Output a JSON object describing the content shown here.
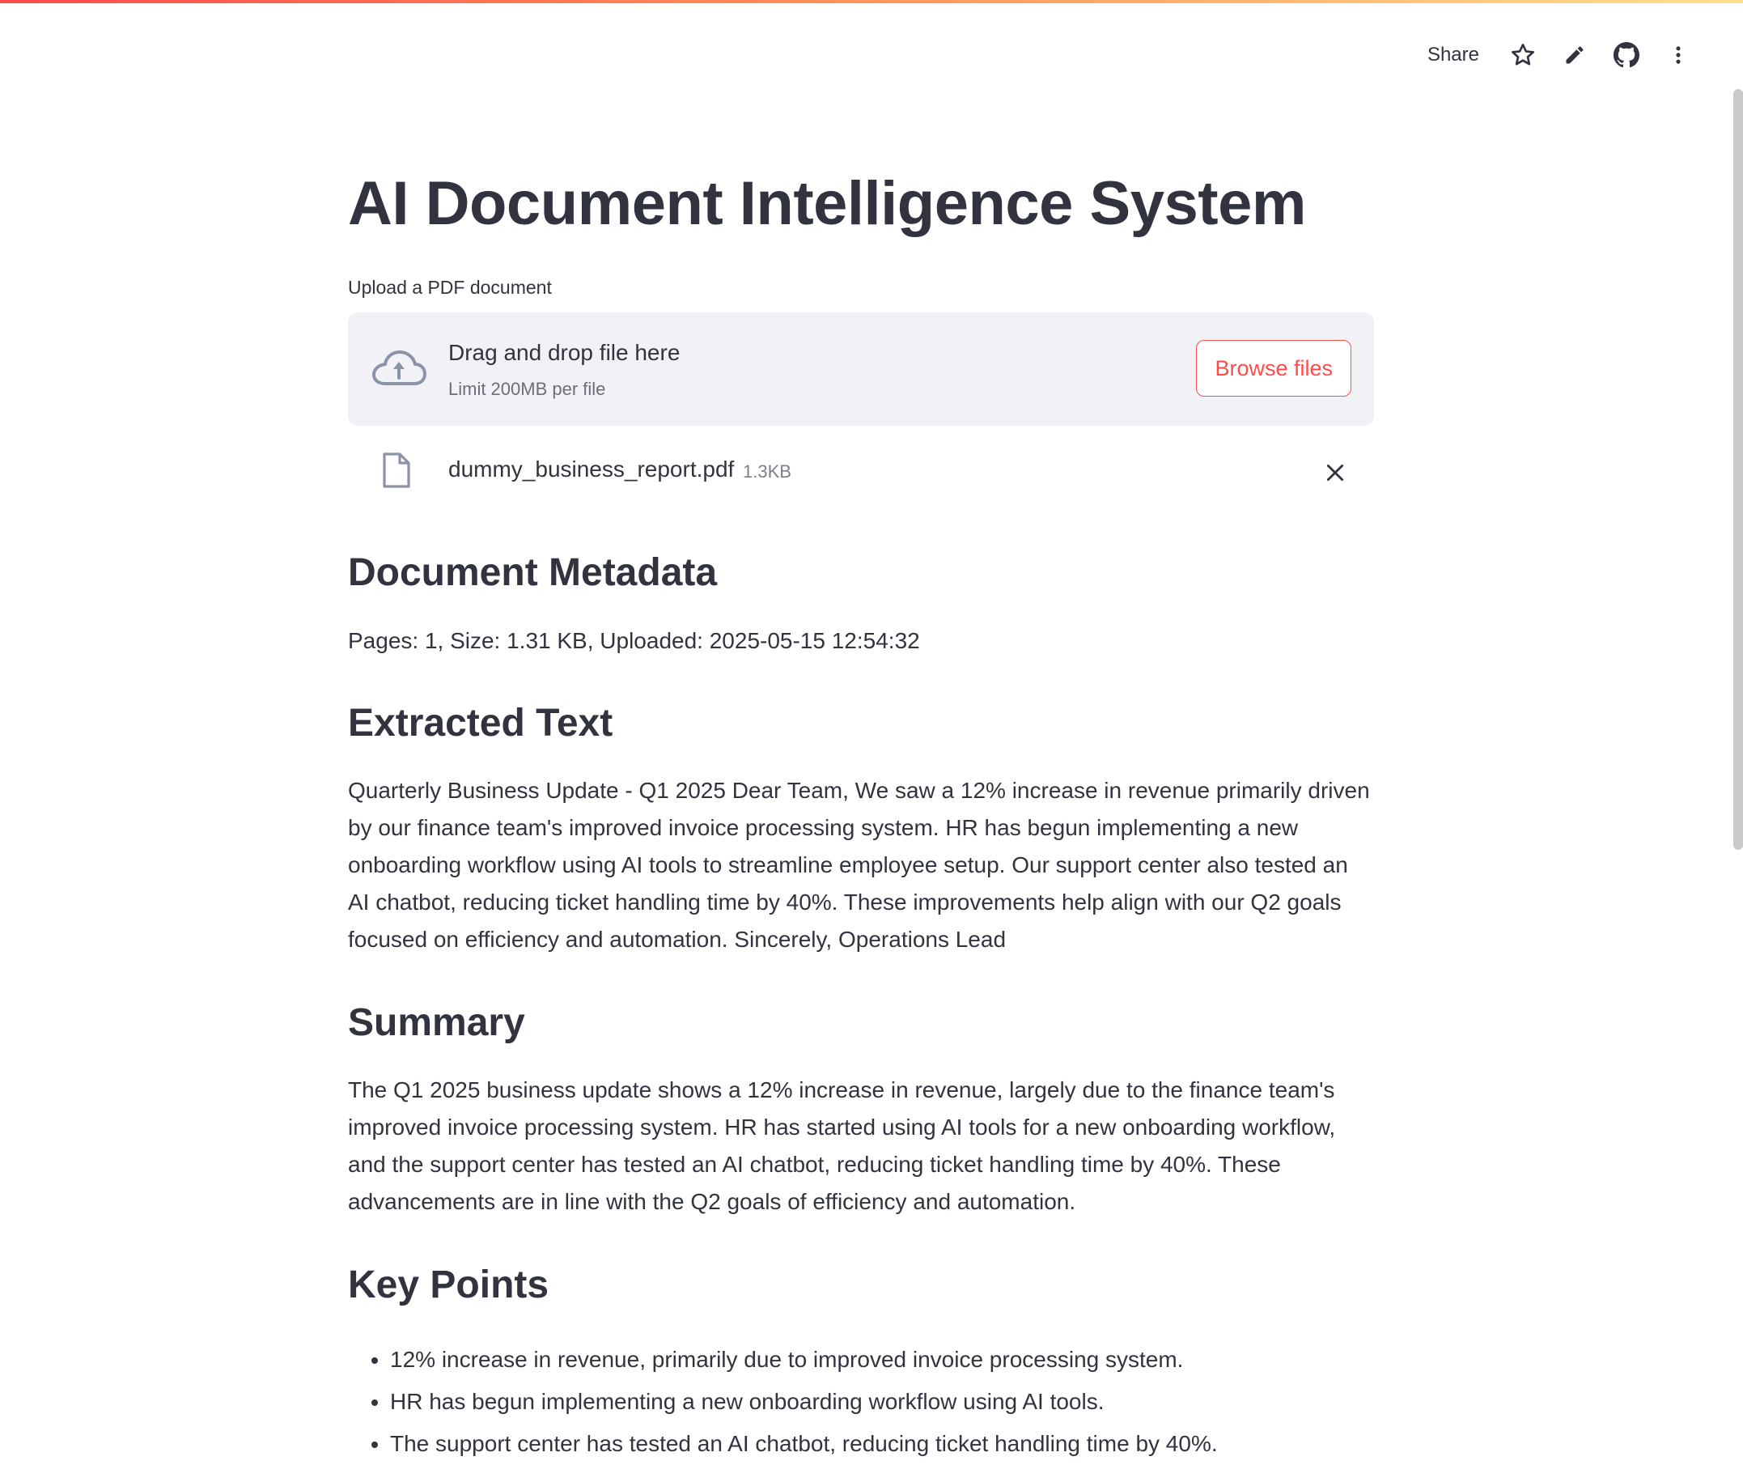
{
  "toolbar": {
    "share_label": "Share",
    "icons": [
      "star-icon",
      "pencil-icon",
      "github-icon",
      "more-vertical-icon"
    ]
  },
  "page": {
    "title": "AI Document Intelligence System"
  },
  "uploader": {
    "label": "Upload a PDF document",
    "drag_text": "Drag and drop file here",
    "limit_text": "Limit 200MB per file",
    "browse_label": "Browse files"
  },
  "uploaded_file": {
    "name": "dummy_business_report.pdf",
    "size": "1.3KB"
  },
  "metadata": {
    "heading": "Document Metadata",
    "text": "Pages: 1, Size: 1.31 KB, Uploaded: 2025-05-15 12:54:32"
  },
  "extracted": {
    "heading": "Extracted Text",
    "text": "Quarterly Business Update - Q1 2025 Dear Team, We saw a 12% increase in revenue primarily driven by our finance team's improved invoice processing system. HR has begun implementing a new onboarding workflow using AI tools to streamline employee setup. Our support center also tested an AI chatbot, reducing ticket handling time by 40%. These improvements help align with our Q2 goals focused on efficiency and automation. Sincerely, Operations Lead"
  },
  "summary": {
    "heading": "Summary",
    "text": "The Q1 2025 business update shows a 12% increase in revenue, largely due to the finance team's improved invoice processing system. HR has started using AI tools for a new onboarding workflow, and the support center has tested an AI chatbot, reducing ticket handling time by 40%. These advancements are in line with the Q2 goals of efficiency and automation."
  },
  "key_points": {
    "heading": "Key Points",
    "items": [
      "12% increase in revenue, primarily due to improved invoice processing system.",
      "HR has begun implementing a new onboarding workflow using AI tools.",
      "The support center has tested an AI chatbot, reducing ticket handling time by 40%."
    ]
  },
  "colors": {
    "accent": "#ff4b4b",
    "text": "#31333f",
    "dropzone_bg": "#f0f2f6"
  }
}
